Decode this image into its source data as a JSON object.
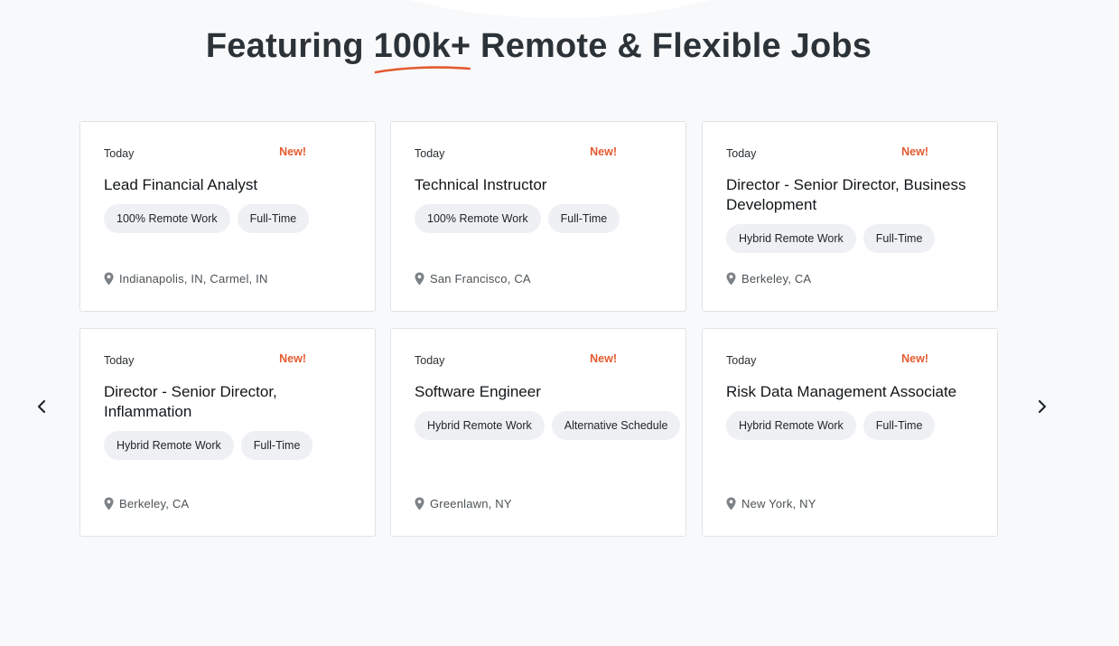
{
  "headline": {
    "before": "Featuring ",
    "accent": "100k+",
    "after": " Remote & Flexible Jobs"
  },
  "colors": {
    "accent": "#e35b30",
    "heading": "#2c3338",
    "tag_bg": "#eef0f4",
    "card_border": "#dfe3e6",
    "page_bg": "#f8f9fa"
  },
  "carousel": {
    "prev_icon": "chevron-left-icon",
    "next_icon": "chevron-right-icon"
  },
  "jobs": [
    {
      "date": "Today",
      "badge": "New!",
      "title": "Lead Financial Analyst",
      "tags": [
        "100% Remote Work",
        "Full-Time"
      ],
      "location": "Indianapolis, IN, Carmel, IN"
    },
    {
      "date": "Today",
      "badge": "New!",
      "title": "Technical Instructor",
      "tags": [
        "100% Remote Work",
        "Full-Time"
      ],
      "location": "San Francisco, CA"
    },
    {
      "date": "Today",
      "badge": "New!",
      "title": "Director - Senior Director, Business Development",
      "tags": [
        "Hybrid Remote Work",
        "Full-Time"
      ],
      "location": "Berkeley, CA"
    },
    {
      "date": "Today",
      "badge": "New!",
      "title": "Director - Senior Director, Inflammation",
      "tags": [
        "Hybrid Remote Work",
        "Full-Time"
      ],
      "location": "Berkeley, CA"
    },
    {
      "date": "Today",
      "badge": "New!",
      "title": "Software Engineer",
      "tags": [
        "Hybrid Remote Work",
        "Alternative Schedule"
      ],
      "location": "Greenlawn, NY"
    },
    {
      "date": "Today",
      "badge": "New!",
      "title": "Risk Data Management Associate",
      "tags": [
        "Hybrid Remote Work",
        "Full-Time"
      ],
      "location": "New York, NY"
    }
  ]
}
